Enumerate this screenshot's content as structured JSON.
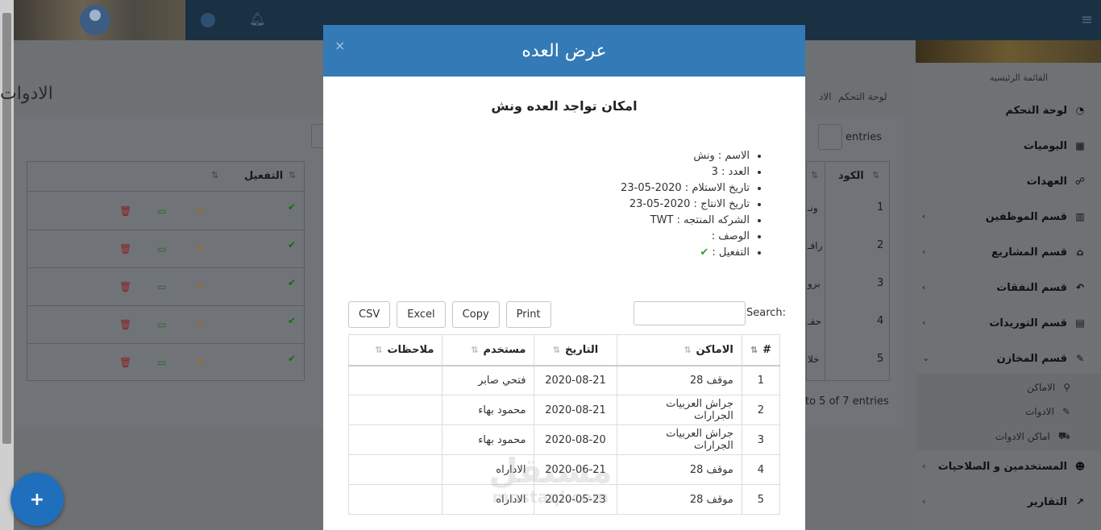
{
  "background": {
    "page_title": "الادوات",
    "breadcrumb": [
      "لوحة التحكم",
      "الاد"
    ],
    "entries_label": "entries",
    "info_text": "to 5 of 7 entries",
    "table_headers": {
      "code": "الكود",
      "activation": "التفعيل"
    },
    "rows": [
      {
        "num": "1",
        "name": "ونـ"
      },
      {
        "num": "2",
        "name": "رافـ"
      },
      {
        "num": "3",
        "name": "برو"
      },
      {
        "num": "4",
        "name": "حفـ"
      },
      {
        "num": "5",
        "name": "خلا"
      }
    ]
  },
  "sidebar": {
    "caption": "القائمة الرئيسيه",
    "items": [
      {
        "label": "لوحة التحكم",
        "icon": "dashboard-icon",
        "glyph": "◔"
      },
      {
        "label": "اليوميات",
        "icon": "calendar-icon",
        "glyph": "▦"
      },
      {
        "label": "العهدات",
        "icon": "handshake-icon",
        "glyph": "☍"
      },
      {
        "label": "قسم الموظفين",
        "icon": "chart-icon",
        "glyph": "▥"
      },
      {
        "label": "قسم المشاريع",
        "icon": "bank-icon",
        "glyph": "⌂"
      },
      {
        "label": "قسم النفقات",
        "icon": "reply-icon",
        "glyph": "↶"
      },
      {
        "label": "قسم التوريدات",
        "icon": "list-card-icon",
        "glyph": "▤"
      },
      {
        "label": "قسم المخازن",
        "icon": "wrench-icon",
        "glyph": "✎"
      },
      {
        "label": "المستخدمين و الصلاحيات",
        "icon": "users-icon",
        "glyph": "☻"
      },
      {
        "label": "التقارير",
        "icon": "line-chart-icon",
        "glyph": "↗"
      }
    ],
    "sub_items": [
      {
        "label": "الاماكن",
        "icon": "map-marker-icon",
        "glyph": "⚲"
      },
      {
        "label": "الادوات",
        "icon": "wrench-icon",
        "glyph": "✎"
      },
      {
        "label": "اماكن الادوات",
        "icon": "truck-icon",
        "glyph": "⛟"
      }
    ]
  },
  "fab": {
    "label": "+"
  },
  "modal": {
    "title": "عرض العده",
    "close": "×",
    "subtitle": "امكان تواجد العده ونش",
    "details": [
      "الاسم : ونش",
      "العدد : 3",
      "تاريخ الاستلام : 2020-05-23",
      "تاريخ الانتاج : 2020-05-23",
      "الشركه المنتجه : TWT",
      "الوصف :"
    ],
    "activation_label": "التفعيل :",
    "activation_mark": "✔",
    "buttons": {
      "print": "Print",
      "copy": "Copy",
      "excel": "Excel",
      "csv": "CSV"
    },
    "search_label": "Search:",
    "table": {
      "headers": {
        "num": "#",
        "location": "الاماكن",
        "date": "التاريخ",
        "user": "مستخدم",
        "notes": "ملاحظات"
      },
      "rows": [
        {
          "num": "1",
          "location": "موقف 28",
          "date": "2020-08-21",
          "user": "فتحي صابر",
          "notes": ""
        },
        {
          "num": "2",
          "location": "جراش العربيات الجرارات",
          "date": "2020-08-21",
          "user": "محمود بهاء",
          "notes": ""
        },
        {
          "num": "3",
          "location": "جراش العربيات الجرارات",
          "date": "2020-08-20",
          "user": "محمود بهاء",
          "notes": ""
        },
        {
          "num": "4",
          "location": "موقف 28",
          "date": "2020-06-21",
          "user": "الاداراه",
          "notes": ""
        },
        {
          "num": "5",
          "location": "موقف 28",
          "date": "2020-05-23",
          "user": "الاداراه",
          "notes": ""
        }
      ]
    }
  },
  "watermark": {
    "big": "مستقل",
    "small": "mostaql.com"
  }
}
